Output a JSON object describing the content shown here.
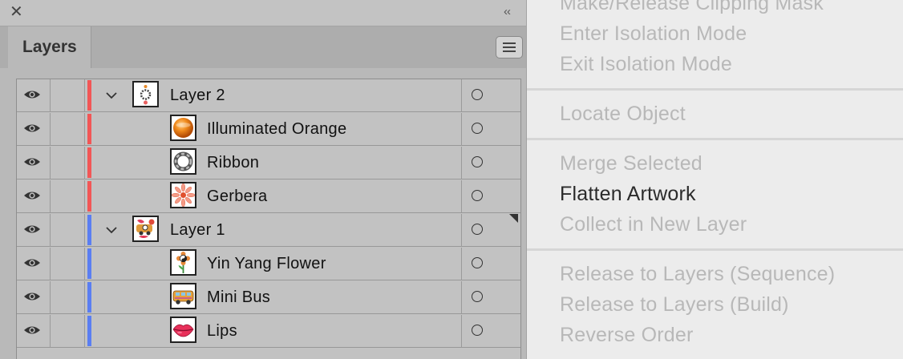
{
  "panel": {
    "close_glyph": "✕",
    "collapse_glyph": "‹‹",
    "tab_label": "Layers",
    "menu_icon": "hamburger-icon"
  },
  "layers": [
    {
      "name": "Layer 2",
      "type": "layer",
      "expanded": true,
      "color": "#f25656",
      "thumb": "layer2-thumb"
    },
    {
      "name": "Illuminated Orange",
      "type": "sublayer",
      "color": "#f25656",
      "thumb": "orange-sphere"
    },
    {
      "name": "Ribbon",
      "type": "sublayer",
      "color": "#f25656",
      "thumb": "ribbon-ring"
    },
    {
      "name": "Gerbera",
      "type": "sublayer",
      "color": "#f25656",
      "thumb": "gerbera-flower"
    },
    {
      "name": "Layer 1",
      "type": "layer",
      "expanded": true,
      "color": "#5a7ef2",
      "thumb": "layer1-thumb"
    },
    {
      "name": "Yin Yang Flower",
      "type": "sublayer",
      "color": "#5a7ef2",
      "thumb": "yinyang-flower"
    },
    {
      "name": "Mini Bus",
      "type": "sublayer",
      "color": "#5a7ef2",
      "thumb": "mini-bus"
    },
    {
      "name": "Lips",
      "type": "sublayer",
      "color": "#5a7ef2",
      "thumb": "lips"
    }
  ],
  "menu": {
    "items": [
      {
        "label": "Make/Release Clipping Mask",
        "enabled": false
      },
      {
        "label": "Enter Isolation Mode",
        "enabled": false
      },
      {
        "label": "Exit Isolation Mode",
        "enabled": false
      },
      {
        "label": "Locate Object",
        "enabled": false
      },
      {
        "label": "Merge Selected",
        "enabled": false
      },
      {
        "label": "Flatten Artwork",
        "enabled": true
      },
      {
        "label": "Collect in New Layer",
        "enabled": false
      },
      {
        "label": "Release to Layers (Sequence)",
        "enabled": false
      },
      {
        "label": "Release to Layers (Build)",
        "enabled": false
      },
      {
        "label": "Reverse Order",
        "enabled": false
      }
    ]
  }
}
